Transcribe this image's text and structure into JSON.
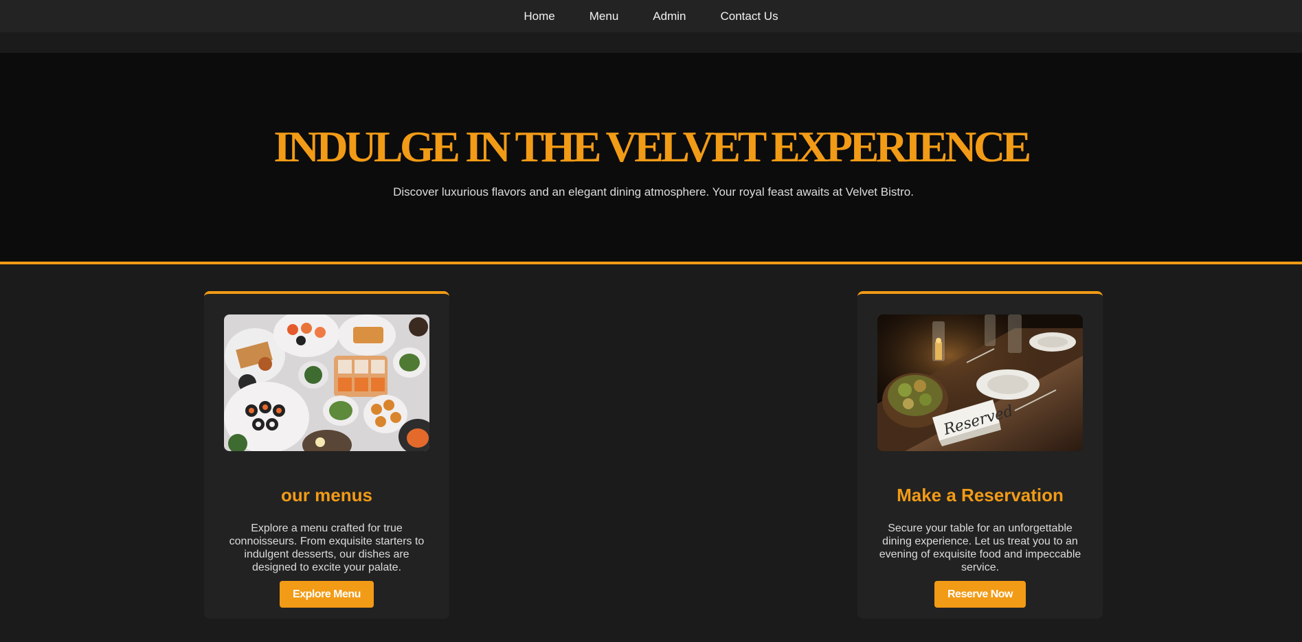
{
  "nav": {
    "items": [
      {
        "label": "Home"
      },
      {
        "label": "Menu"
      },
      {
        "label": "Admin"
      },
      {
        "label": "Contact Us"
      }
    ]
  },
  "hero": {
    "title": "INDULGE IN THE VELVET EXPERIENCE",
    "subtitle": "Discover luxurious flavors and an elegant dining atmosphere. Your royal feast awaits at Velvet Bistro."
  },
  "cards": [
    {
      "title": "our menus",
      "text": "Explore a menu crafted for true connoisseurs. From exquisite starters to indulgent desserts, our dishes are designed to excite your palate.",
      "button": "Explore Menu",
      "image": "food-platter-photo"
    },
    {
      "title": "Make a Reservation",
      "text": "Secure your table for an unforgettable dining experience. Let us treat you to an evening of exquisite food and impeccable service.",
      "button": "Reserve Now",
      "image": "reserved-table-photo",
      "image_sign_text": "Reserved"
    }
  ],
  "colors": {
    "accent": "#f29b16",
    "background": "#1b1b1b",
    "hero_background": "#0c0c0c",
    "card_background": "#222222"
  }
}
